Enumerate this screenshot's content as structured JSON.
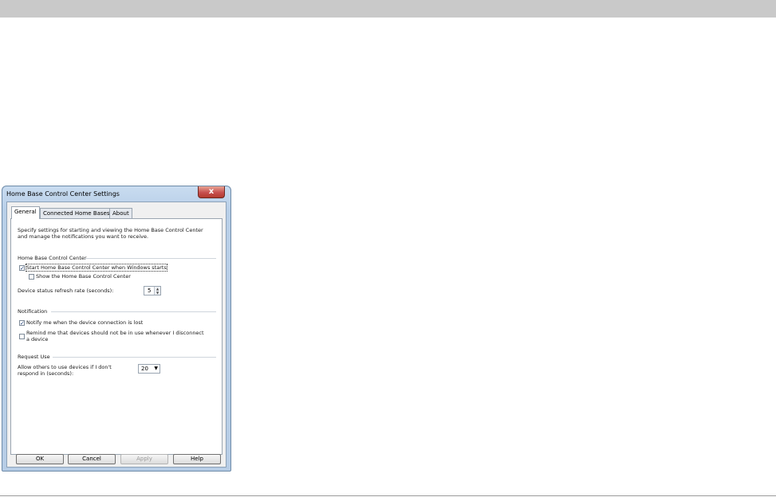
{
  "window": {
    "title": "Home Base Control Center Settings",
    "close_glyph": "x"
  },
  "tabs": [
    {
      "label": "General",
      "active": true
    },
    {
      "label": "Connected Home Bases",
      "active": false
    },
    {
      "label": "About",
      "active": false
    }
  ],
  "intro": {
    "line1": "Specify settings for starting and viewing the Home Base Control Center",
    "line2": "and manage the notifications you want to receive."
  },
  "sections": {
    "control_center": {
      "heading": "Home Base Control Center",
      "start_with_windows": {
        "label": "Start Home Base Control Center when Windows starts",
        "checked": true
      },
      "show_control_center": {
        "label": "Show the Home Base Control Center",
        "checked": false
      },
      "refresh_rate": {
        "label": "Device status refresh rate (seconds):",
        "value": "5"
      }
    },
    "notification": {
      "heading": "Notification",
      "notify_lost": {
        "label": "Notify me when the device connection is lost",
        "checked": true
      },
      "remind": {
        "label_line1": "Remind me that devices should not be in use whenever I disconnect",
        "label_line2": "a device",
        "checked": false
      }
    },
    "request_use": {
      "heading": "Request Use",
      "allow_label_line1": "Allow others to use devices if I don't",
      "allow_label_line2": "respond in (seconds):",
      "timeout_value": "20"
    }
  },
  "buttons": {
    "ok": "OK",
    "cancel": "Cancel",
    "apply": "Apply",
    "help": "Help"
  },
  "glyphs": {
    "check": "✓",
    "spin_up": "▲",
    "spin_down": "▼",
    "dropdown": "▼"
  }
}
